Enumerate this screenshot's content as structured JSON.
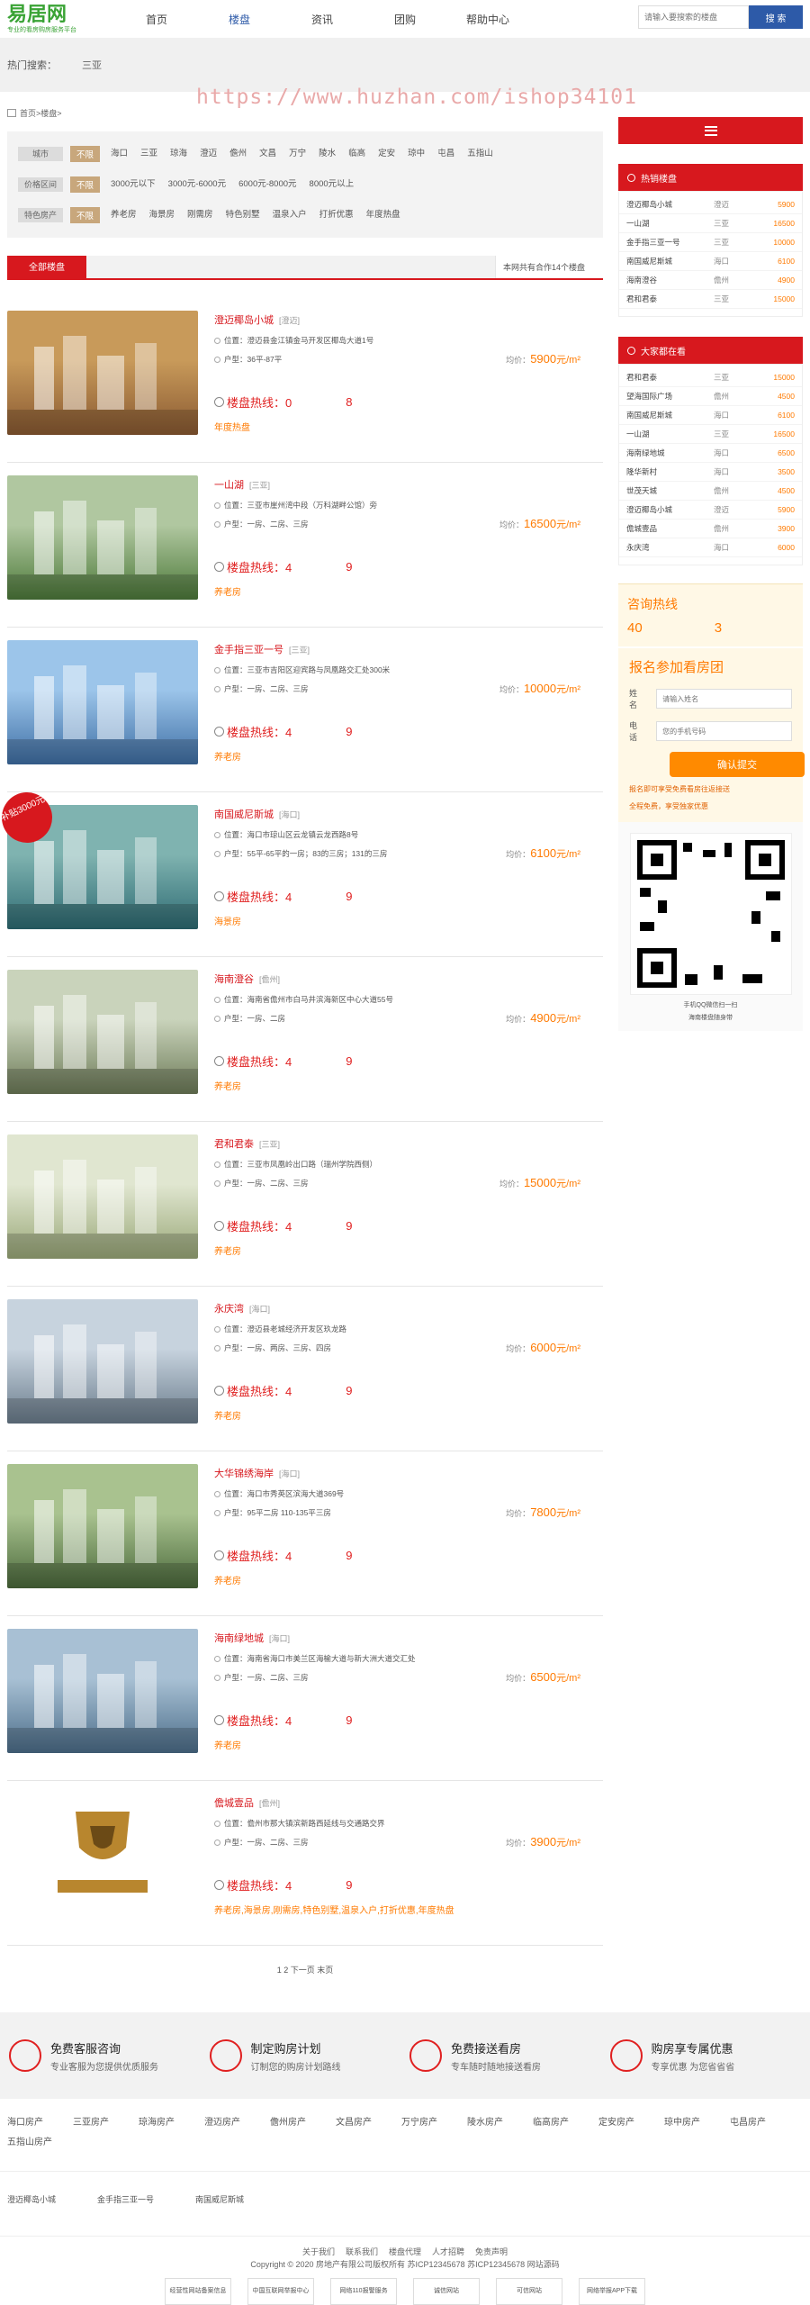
{
  "header": {
    "logo": "易居网",
    "logo_sub": "专业的看房购房服务平台",
    "nav": [
      {
        "label": "首页"
      },
      {
        "label": "楼盘"
      },
      {
        "label": "资讯"
      },
      {
        "label": "团购"
      },
      {
        "label": "帮助中心"
      }
    ],
    "search_placeholder": "请输入要搜索的楼盘",
    "search_btn": "搜 索"
  },
  "hotbar": {
    "label": "热门搜索：",
    "keyword": "三亚"
  },
  "watermark": "https://www.huzhan.com/ishop34101",
  "breadcrumb": "首页>楼盘>",
  "filters": {
    "city_label": "城市",
    "cities": [
      "不限",
      "海口",
      "三亚",
      "琼海",
      "澄迈",
      "儋州",
      "文昌",
      "万宁",
      "陵水",
      "临高",
      "定安",
      "琼中",
      "屯昌",
      "五指山"
    ],
    "price_label": "价格区间",
    "prices": [
      "不限",
      "3000元以下",
      "3000元-6000元",
      "6000元-8000元",
      "8000元以上"
    ],
    "feature_label": "特色房产",
    "features": [
      "不限",
      "养老房",
      "海景房",
      "刚需房",
      "特色别墅",
      "温泉入户",
      "打折优惠",
      "年度热盘"
    ]
  },
  "tabs": {
    "all": "全部楼盘",
    "total": "本网共有合作14个楼盘"
  },
  "list": [
    {
      "name": "澄迈椰岛小城",
      "area": "[澄迈]",
      "addr": "位置：澄迈县金江镇金马开发区椰岛大道1号",
      "type": "户型：36平-87平",
      "price": "5900",
      "hotline": "楼盘热线：0",
      "hot_end": "8",
      "tags": "年度热盘",
      "badge": ""
    },
    {
      "name": "一山湖",
      "area": "[三亚]",
      "addr": "位置：三亚市崖州湾中段（万科湖畔公馆）旁",
      "type": "户型：一房、二房、三房",
      "price": "16500",
      "hotline": "楼盘热线：4",
      "hot_end": "9",
      "tags": "养老房",
      "badge": ""
    },
    {
      "name": "金手指三亚一号",
      "area": "[三亚]",
      "addr": "位置：三亚市吉阳区迎宾路与凤凰路交汇处300米",
      "type": "户型：一房、二房、三房",
      "price": "10000",
      "hotline": "楼盘热线：4",
      "hot_end": "9",
      "tags": "养老房",
      "badge": ""
    },
    {
      "name": "南国威尼斯城",
      "area": "[海口]",
      "addr": "位置：海口市琼山区云龙镇云龙西路8号",
      "type": "户型：55平-65平的一房；83的三房；131的三房",
      "price": "6100",
      "hotline": "楼盘热线：4",
      "hot_end": "9",
      "tags": "海景房",
      "badge": "补贴3000元"
    },
    {
      "name": "海南澄谷",
      "area": "[儋州]",
      "addr": "位置：海南省儋州市白马井滨海新区中心大道55号",
      "type": "户型：一房、二房",
      "price": "4900",
      "hotline": "楼盘热线：4",
      "hot_end": "9",
      "tags": "养老房",
      "badge": ""
    },
    {
      "name": "君和君泰",
      "area": "[三亚]",
      "addr": "位置：三亚市凤凰岭出口路（瑞州学院西侧）",
      "type": "户型：一房、二房、三房",
      "price": "15000",
      "hotline": "楼盘热线：4",
      "hot_end": "9",
      "tags": "养老房",
      "badge": ""
    },
    {
      "name": "永庆湾",
      "area": "[海口]",
      "addr": "位置：澄迈县老城经济开发区玖龙路",
      "type": "户型：一房、两房、三房、四房",
      "price": "6000",
      "hotline": "楼盘热线：4",
      "hot_end": "9",
      "tags": "养老房",
      "badge": ""
    },
    {
      "name": "大华锦绣海岸",
      "area": "[海口]",
      "addr": "位置：海口市秀英区滨海大道369号",
      "type": "户型：95平二房 110-135平三房",
      "price": "7800",
      "hotline": "楼盘热线：4",
      "hot_end": "9",
      "tags": "养老房",
      "badge": ""
    },
    {
      "name": "海南绿地城",
      "area": "[海口]",
      "addr": "位置：海南省海口市美兰区海榆大道与新大洲大道交汇处",
      "type": "户型：一房、二房、三房",
      "price": "6500",
      "hotline": "楼盘热线：4",
      "hot_end": "9",
      "tags": "养老房",
      "badge": ""
    },
    {
      "name": "儋城壹品",
      "area": "[儋州]",
      "addr": "位置：儋州市那大镇滨新路西延线与交通路交界",
      "type": "户型：一房、二房、三房",
      "price": "3900",
      "hotline": "楼盘热线：4",
      "hot_end": "9",
      "tags": "养老房,海景房,刚需房,特色别墅,温泉入户,打折优惠,年度热盘",
      "badge": ""
    }
  ],
  "price_prefix": "均价：",
  "price_unit": "元/m²",
  "pager": "1 2 下一页 末页",
  "side": {
    "hot_title": "热销楼盘",
    "hot": [
      {
        "n": "澄迈椰岛小城",
        "a": "澄迈",
        "p": "5900"
      },
      {
        "n": "一山湖",
        "a": "三亚",
        "p": "16500"
      },
      {
        "n": "金手指三亚一号",
        "a": "三亚",
        "p": "10000"
      },
      {
        "n": "南国威尼斯城",
        "a": "海口",
        "p": "6100"
      },
      {
        "n": "海南澄谷",
        "a": "儋州",
        "p": "4900"
      },
      {
        "n": "君和君泰",
        "a": "三亚",
        "p": "15000"
      }
    ],
    "see_title": "大家都在看",
    "see": [
      {
        "n": "君和君泰",
        "a": "三亚",
        "p": "15000"
      },
      {
        "n": "望海国际广场",
        "a": "儋州",
        "p": "4500"
      },
      {
        "n": "南国威尼斯城",
        "a": "海口",
        "p": "6100"
      },
      {
        "n": "一山湖",
        "a": "三亚",
        "p": "16500"
      },
      {
        "n": "海南绿地城",
        "a": "海口",
        "p": "6500"
      },
      {
        "n": "隆华新村",
        "a": "海口",
        "p": "3500"
      },
      {
        "n": "世茂天城",
        "a": "儋州",
        "p": "4500"
      },
      {
        "n": "澄迈椰岛小城",
        "a": "澄迈",
        "p": "5900"
      },
      {
        "n": "儋城壹品",
        "a": "儋州",
        "p": "3900"
      },
      {
        "n": "永庆湾",
        "a": "海口",
        "p": "6000"
      }
    ],
    "consult_title": "咨询热线",
    "consult_num": "40",
    "consult_end": "3",
    "signup_title": "报名参加看房团",
    "name_label": "姓  名",
    "name_ph": "请输入姓名",
    "phone_label": "电  话",
    "phone_ph": "您的手机号码",
    "submit": "确认提交",
    "note1": "报名即可享受免费看房往返接送",
    "note2": "全程免费，享受独家优惠",
    "qr_line1": "手机QQ微信扫一扫",
    "qr_line2": "海南楼盘随身带"
  },
  "services": [
    {
      "t": "免费客服咨询",
      "d": "专业客服为您提供优质服务"
    },
    {
      "t": "制定购房计划",
      "d": "订制您的购房计划路线"
    },
    {
      "t": "免费接送看房",
      "d": "专车随时随地接送看房"
    },
    {
      "t": "购房享专属优惠",
      "d": "专享优惠 为您省省省"
    }
  ],
  "cities": [
    "海口房产",
    "三亚房产",
    "琼海房产",
    "澄迈房产",
    "儋州房产",
    "文昌房产",
    "万宁房产",
    "陵水房产",
    "临高房产",
    "定安房产",
    "琼中房产",
    "屯昌房产",
    "五指山房产"
  ],
  "links": [
    "澄迈椰岛小城",
    "金手指三亚一号",
    "南国威尼斯城"
  ],
  "footer": {
    "nav": [
      "关于我们",
      "联系我们",
      "楼盘代理",
      "人才招聘",
      "免责声明"
    ],
    "copy": "Copyright © 2020 房地产有限公司版权所有   苏ICP12345678   苏ICP12345678   网站源码",
    "seals": [
      "经营性网站备案信息",
      "中国互联网举报中心",
      "网络110报警服务",
      "诚信网站",
      "可信网站",
      "网络举报APP下载"
    ]
  }
}
